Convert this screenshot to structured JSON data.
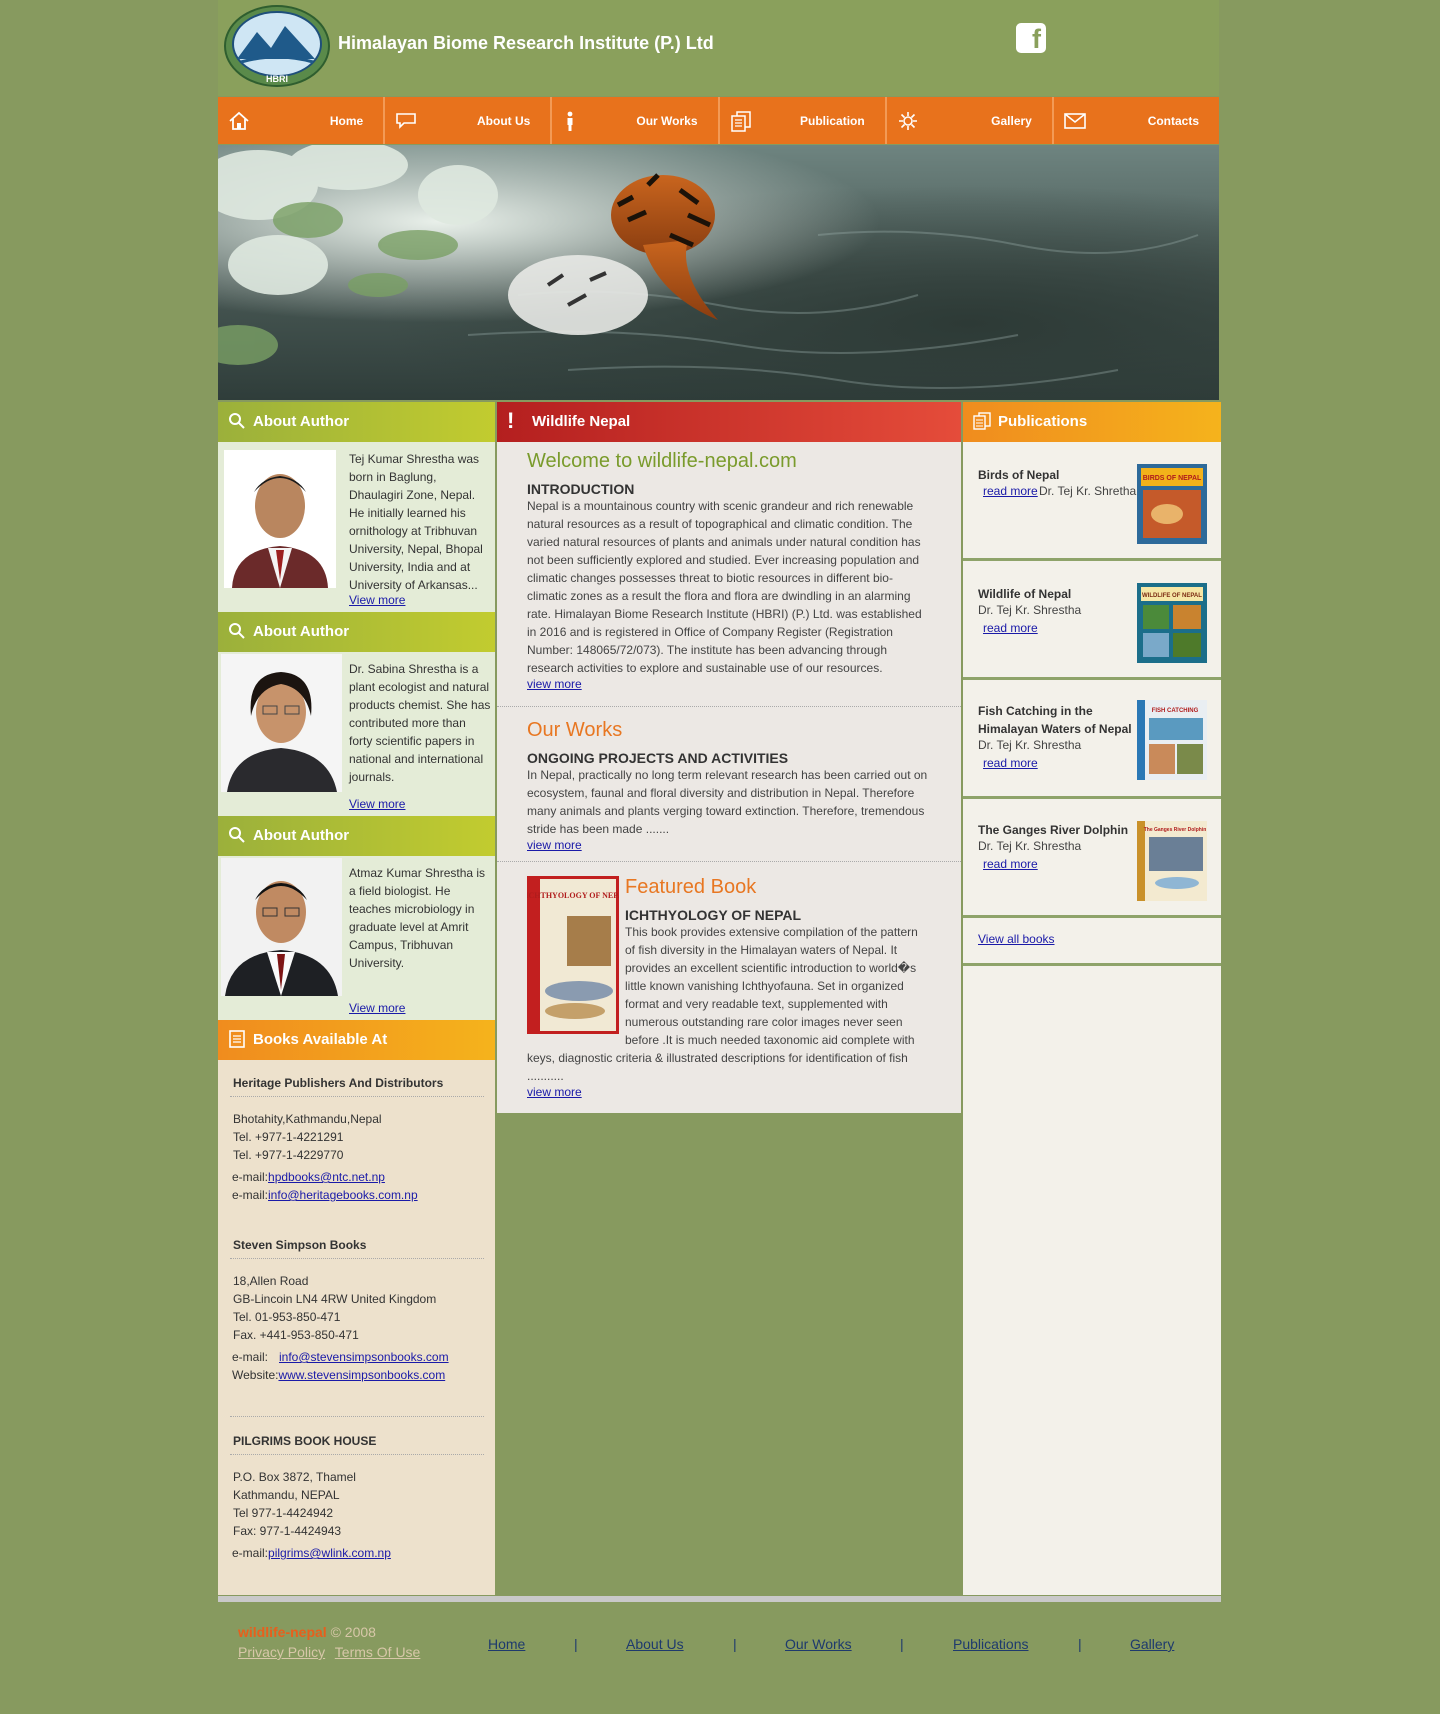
{
  "header": {
    "title": "Himalayan Biome Research Institute (P.) Ltd",
    "logo_text": "HBRI"
  },
  "nav": [
    {
      "label": "Home",
      "icon": "home-icon"
    },
    {
      "label": "About Us",
      "icon": "speech-bubble-icon"
    },
    {
      "label": "Our Works",
      "icon": "person-icon"
    },
    {
      "label": "Publication",
      "icon": "documents-icon"
    },
    {
      "label": "Gallery",
      "icon": "gallery-icon"
    },
    {
      "label": "Contacts",
      "icon": "envelope-icon"
    }
  ],
  "left": {
    "authors": [
      {
        "heading": "About Author",
        "text": "Tej Kumar Shrestha was born in Baglung, Dhaulagiri Zone, Nepal. He initially learned his ornithology at Tribhuvan University, Nepal, Bhopal University, India and at University of Arkansas...",
        "more": "View more"
      },
      {
        "heading": "About Author",
        "text": "Dr. Sabina Shrestha is a plant ecologist and natural products chemist. She has contributed more than forty scientific papers in national and international journals.",
        "more": "View more"
      },
      {
        "heading": "About Author",
        "text": "Atmaz Kumar Shrestha is a field biologist. He teaches microbiology in graduate level at Amrit Campus, Tribhuvan University.",
        "more": "View more"
      }
    ],
    "books_heading": "Books Available At",
    "stores": [
      {
        "name": "Heritage Publishers And Distributors",
        "lines": [
          "Bhotahity,Kathmandu,Nepal",
          "Tel. +977-1-4221291",
          "Tel. +977-1-4229770"
        ],
        "contacts": [
          {
            "label": "e-mail:",
            "value": "hpdbooks@ntc.net.np"
          },
          {
            "label": "e-mail:",
            "value": "info@heritagebooks.com.np"
          }
        ]
      },
      {
        "name": "Steven Simpson Books",
        "lines": [
          "18,Allen Road",
          "GB-Lincoin LN4 4RW United Kingdom",
          "Tel. 01-953-850-471",
          "Fax. +441-953-850-471"
        ],
        "contacts": [
          {
            "label": "e-mail:",
            "value": "info@stevensimpsonbooks.com"
          },
          {
            "label": "Website:",
            "value": "www.stevensimpsonbooks.com"
          }
        ]
      },
      {
        "name": "PILGRIMS BOOK HOUSE",
        "lines": [
          "P.O. Box 3872, Thamel",
          "Kathmandu, NEPAL",
          "Tel 977-1-4424942",
          "Fax: 977-1-4424943"
        ],
        "contacts": [
          {
            "label": "e-mail:",
            "value": "pilgrims@wlink.com.np"
          }
        ]
      }
    ]
  },
  "middle": {
    "heading": "Wildlife Nepal",
    "welcome": "Welcome to wildlife-nepal.com",
    "intro_title": "INTRODUCTION",
    "intro_text": "Nepal is a mountainous country with scenic grandeur and rich renewable natural resources as a result of topographical and climatic condition. The varied natural resources of plants and animals under natural condition has not been sufficiently explored and studied. Ever increasing population and climatic changes possesses threat to biotic resources in different bio-climatic zones as a result the flora and flora are dwindling in an alarming rate. Himalayan Biome Research Institute (HBRI) (P.) Ltd. was established in 2016 and is registered in Office of Company Register (Registration Number: 148065/72/073). The institute has been advancing through research activities to explore and sustainable use of our resources.",
    "intro_more": "view more",
    "works_title": "Our Works",
    "works_sub": "ONGOING PROJECTS AND ACTIVITIES",
    "works_text": "In Nepal, practically no long term relevant research has been carried out on ecosystem, faunal and floral diversity and distribution in Nepal. Therefore many animals and plants verging toward extinction. Therefore, tremendous stride has been made .......",
    "works_more": "view more",
    "featured_title": "Featured Book",
    "featured_sub": "ICHTHYOLOGY OF NEPAL",
    "featured_text": "This book provides extensive compilation of the pattern of fish diversity in the Himalayan waters of Nepal. It provides an excellent scientific introduction to world�s little known vanishing Ichthyofauna. Set in organized format and very readable text, supplemented with numerous outstanding rare color images never seen before .It is much needed taxonomic aid complete with keys, diagnostic criteria & illustrated descriptions for identification of fish ...........",
    "featured_more": "view more",
    "featured_cover_text": "ICHTHYOLOGY OF NEPAL"
  },
  "right": {
    "heading": "Publications",
    "books": [
      {
        "title": "Birds of Nepal",
        "author": "Dr. Tej Kr. Shretha",
        "more": "read more",
        "cover_text": "BIRDS OF NEPAL"
      },
      {
        "title": "Wildlife of Nepal",
        "author": "Dr. Tej Kr. Shrestha",
        "more": "read more",
        "cover_text": "WILDLIFE OF NEPAL"
      },
      {
        "title": "Fish Catching in the Himalayan Waters of Nepal",
        "author": "Dr. Tej Kr. Shrestha",
        "more": "read more",
        "cover_text": "FISH CATCHING"
      },
      {
        "title": "The Ganges River Dolphin",
        "author": "Dr. Tej Kr. Shrestha",
        "more": "read more",
        "cover_text": "The Ganges River Dolphin"
      }
    ],
    "view_all": "View all books"
  },
  "footer": {
    "brand": "wildlife-nepal",
    "copyright": "© 2008",
    "privacy": "Privacy Policy",
    "terms": "Terms Of Use",
    "links": [
      "Home",
      "About Us",
      "Our Works",
      "Publications",
      "Gallery"
    ],
    "separator": "|"
  }
}
